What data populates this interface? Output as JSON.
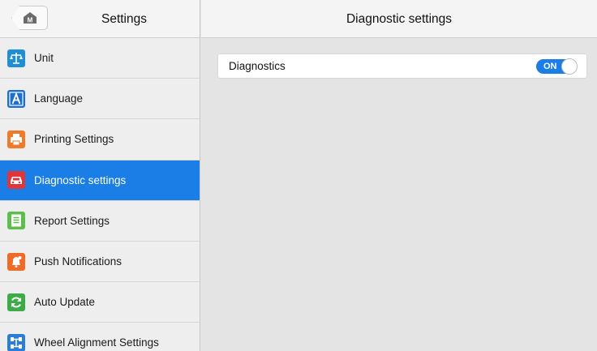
{
  "sidebar": {
    "title": "Settings",
    "home_icon_letter": "M",
    "items": [
      {
        "label": "Unit",
        "icon": "scale-icon",
        "color": "#1e8fd6",
        "active": false
      },
      {
        "label": "Language",
        "icon": "language-a-icon",
        "color": "#1c6fd1",
        "active": false
      },
      {
        "label": "Printing Settings",
        "icon": "printer-icon",
        "color": "#f07a2a",
        "active": false
      },
      {
        "label": "Diagnostic settings",
        "icon": "car-icon",
        "color": "#e0363a",
        "active": true
      },
      {
        "label": "Report Settings",
        "icon": "report-icon",
        "color": "#5bbf4a",
        "active": false
      },
      {
        "label": "Push Notifications",
        "icon": "bell-icon",
        "color": "#f06a28",
        "active": false
      },
      {
        "label": "Auto Update",
        "icon": "refresh-icon",
        "color": "#3dac48",
        "active": false
      },
      {
        "label": "Wheel Alignment Settings",
        "icon": "wheel-alignment-icon",
        "color": "#2a7fd4",
        "active": false
      }
    ]
  },
  "main": {
    "title": "Diagnostic settings",
    "settings": [
      {
        "label": "Diagnostics",
        "toggle_label": "ON",
        "enabled": true
      }
    ]
  },
  "colors": {
    "accent": "#1a7ee6",
    "sidebar_bg": "#eeeeee",
    "content_bg": "#e4e4e4"
  }
}
